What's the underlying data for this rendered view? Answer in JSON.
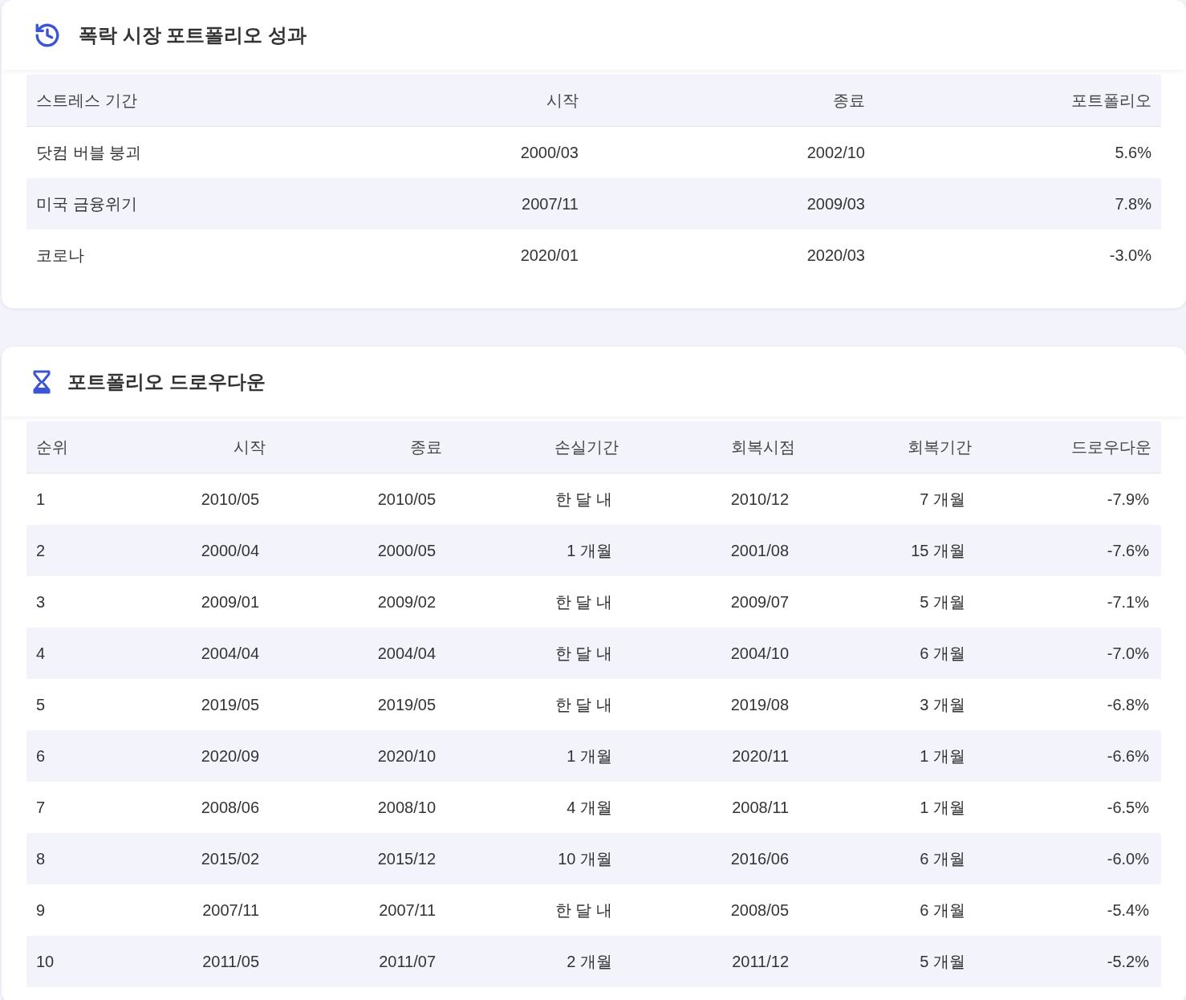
{
  "stress_panel": {
    "title": "폭락 시장 포트폴리오 성과",
    "columns": [
      "스트레스 기간",
      "시작",
      "종료",
      "포트폴리오"
    ],
    "rows": [
      [
        "닷컴 버블 붕괴",
        "2000/03",
        "2002/10",
        "5.6%"
      ],
      [
        "미국 금융위기",
        "2007/11",
        "2009/03",
        "7.8%"
      ],
      [
        "코로나",
        "2020/01",
        "2020/03",
        "-3.0%"
      ]
    ]
  },
  "drawdown_panel": {
    "title": "포트폴리오 드로우다운",
    "columns": [
      "순위",
      "시작",
      "종료",
      "손실기간",
      "회복시점",
      "회복기간",
      "드로우다운"
    ],
    "rows": [
      [
        "1",
        "2010/05",
        "2010/05",
        "한 달 내",
        "2010/12",
        "7 개월",
        "-7.9%"
      ],
      [
        "2",
        "2000/04",
        "2000/05",
        "1 개월",
        "2001/08",
        "15 개월",
        "-7.6%"
      ],
      [
        "3",
        "2009/01",
        "2009/02",
        "한 달 내",
        "2009/07",
        "5 개월",
        "-7.1%"
      ],
      [
        "4",
        "2004/04",
        "2004/04",
        "한 달 내",
        "2004/10",
        "6 개월",
        "-7.0%"
      ],
      [
        "5",
        "2019/05",
        "2019/05",
        "한 달 내",
        "2019/08",
        "3 개월",
        "-6.8%"
      ],
      [
        "6",
        "2020/09",
        "2020/10",
        "1 개월",
        "2020/11",
        "1 개월",
        "-6.6%"
      ],
      [
        "7",
        "2008/06",
        "2008/10",
        "4 개월",
        "2008/11",
        "1 개월",
        "-6.5%"
      ],
      [
        "8",
        "2015/02",
        "2015/12",
        "10 개월",
        "2016/06",
        "6 개월",
        "-6.0%"
      ],
      [
        "9",
        "2007/11",
        "2007/11",
        "한 달 내",
        "2008/05",
        "6 개월",
        "-5.4%"
      ],
      [
        "10",
        "2011/05",
        "2011/07",
        "2 개월",
        "2011/12",
        "5 개월",
        "-5.2%"
      ]
    ]
  }
}
